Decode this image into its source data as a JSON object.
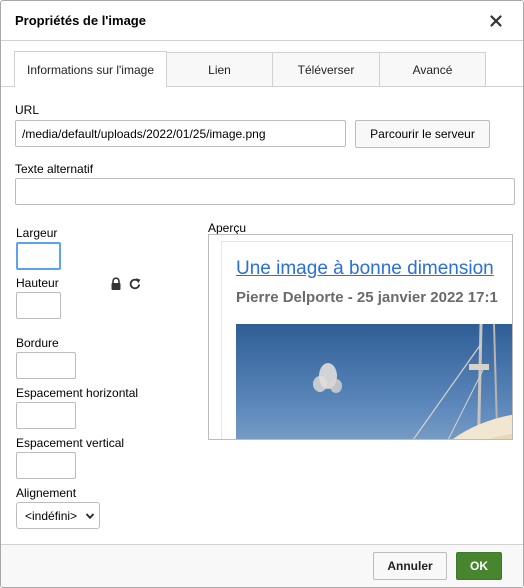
{
  "dialog": {
    "title": "Propriétés de l'image",
    "close_icon": "close-icon"
  },
  "tabs": [
    {
      "label": "Informations sur l'image",
      "active": true
    },
    {
      "label": "Lien",
      "active": false
    },
    {
      "label": "Téléverser",
      "active": false
    },
    {
      "label": "Avancé",
      "active": false
    }
  ],
  "url": {
    "label": "URL",
    "value": "/media/default/uploads/2022/01/25/image.png",
    "browse_label": "Parcourir le serveur"
  },
  "alt": {
    "label": "Texte alternatif",
    "value": ""
  },
  "width": {
    "label": "Largeur",
    "value": ""
  },
  "height": {
    "label": "Hauteur",
    "value": "",
    "lock_icon": "lock-icon",
    "reset_icon": "reset-size-icon"
  },
  "border": {
    "label": "Bordure",
    "value": ""
  },
  "hspace": {
    "label": "Espacement horizontal",
    "value": ""
  },
  "vspace": {
    "label": "Espacement vertical",
    "value": ""
  },
  "align": {
    "label": "Alignement",
    "selected": "<indéfini>"
  },
  "preview": {
    "label": "Aperçu",
    "article_title": "Une image à bonne dimension",
    "article_meta": "Pierre Delporte - 25 janvier 2022 17:1"
  },
  "footer": {
    "cancel_label": "Annuler",
    "ok_label": "OK",
    "ok_color": "#47852f"
  }
}
